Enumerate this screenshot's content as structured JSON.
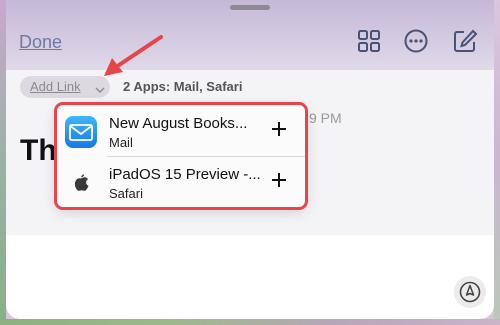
{
  "toolbar": {
    "done_label": "Done",
    "icons": [
      "gallery-grid-icon",
      "more-ellipsis-icon",
      "compose-icon"
    ]
  },
  "tags": {
    "add_link_label": "Add Link",
    "apps_summary": "2 Apps: Mail, Safari"
  },
  "note": {
    "title_fragment": "Th",
    "time_fragment": "9 PM"
  },
  "link_menu": {
    "items": [
      {
        "title": "New August Books...",
        "app": "Mail",
        "icon": "mail-icon",
        "action_icon": "plus-icon"
      },
      {
        "title": "iPadOS 15 Preview -...",
        "app": "Safari",
        "icon": "apple-logo-icon",
        "action_icon": "plus-icon"
      }
    ],
    "highlight_color": "#e8454a"
  },
  "annotation": {
    "arrow_color": "#e8454a"
  },
  "markup_button": {
    "icon": "markup-pen-icon"
  }
}
